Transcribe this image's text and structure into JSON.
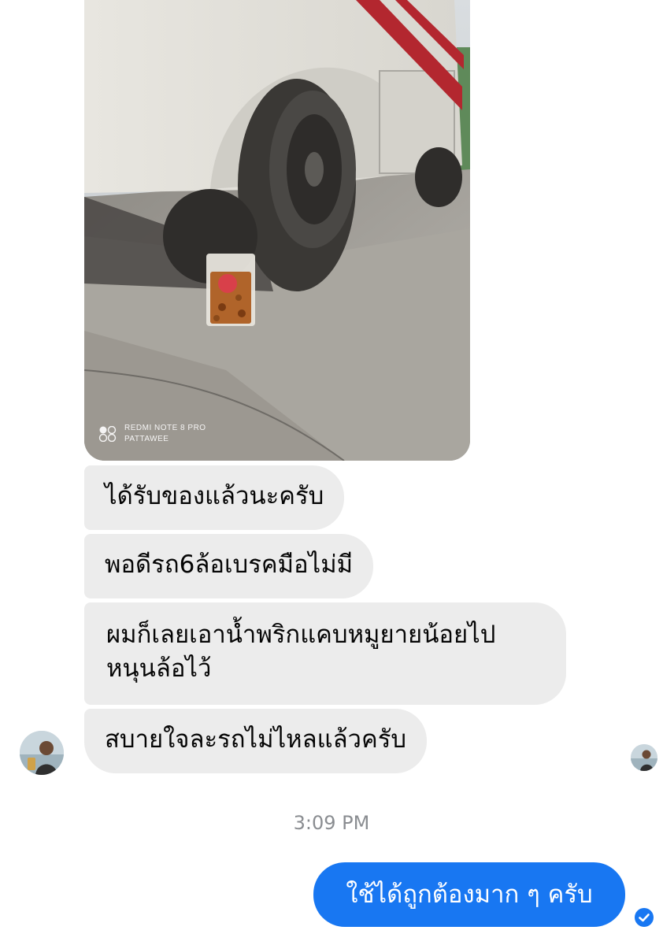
{
  "photo": {
    "watermark_line1": "REDMI NOTE 8 PRO",
    "watermark_line2": "PATTAWEE"
  },
  "messages": [
    {
      "text": "ได้รับของแล้วนะครับ"
    },
    {
      "text": "พอดีรถ6ล้อเบรคมือไม่มี"
    },
    {
      "text": "ผมก็เลยเอาน้ำพริกแคบหมูยายน้อยไป หนุนล้อไว้"
    },
    {
      "text": "สบายใจละรถไม่ไหลแล้วครับ"
    }
  ],
  "timestamp": "3:09 PM",
  "sent_message": "ใช้ได้ถูกต้องมาก ๆ ครับ",
  "colors": {
    "incoming_bubble": "#ececec",
    "outgoing_bubble": "#1877f2",
    "timestamp_text": "#8a8d91"
  },
  "icons": {
    "sent_status": "check-circle-icon",
    "watermark_logo": "camera-dual-circle-icon"
  }
}
